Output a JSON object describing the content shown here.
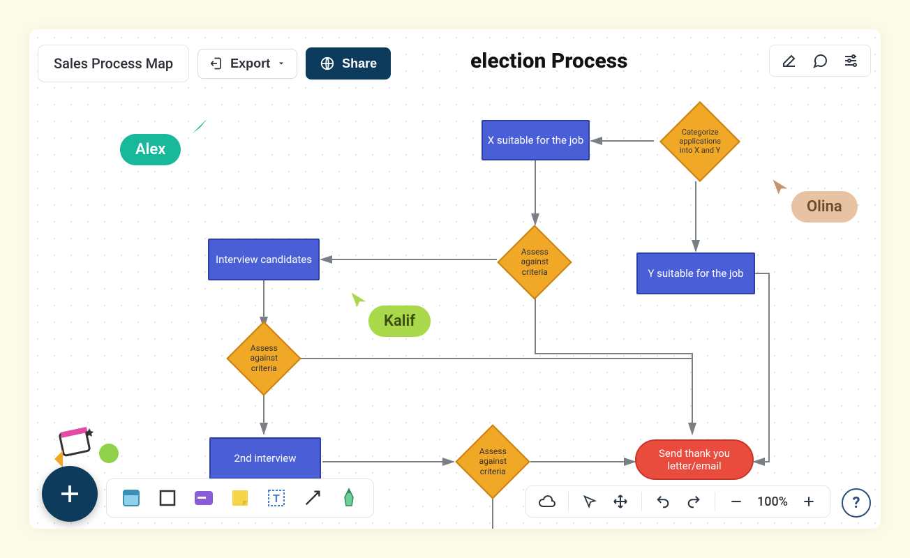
{
  "header": {
    "title": "Sales Process Map",
    "export_label": "Export",
    "share_label": "Share"
  },
  "canvas": {
    "title_partial": "election Process"
  },
  "cursors": {
    "alex": {
      "name": "Alex",
      "color": "#18b89b"
    },
    "kalif": {
      "name": "Kalif",
      "color": "#a9d94a"
    },
    "olina": {
      "name": "Olina",
      "color": "#e3b58f"
    }
  },
  "nodes": {
    "categorize": "Categorize applications into X and Y",
    "x_suitable": "X suitable for the job",
    "y_suitable": "Y suitable for the job",
    "assess1": "Assess against criteria",
    "assess2": "Assess against criteria",
    "assess3": "Assess against criteria",
    "interview": "Interview candidates",
    "interview2": "2nd interview",
    "sendthanks": "Send thank you letter/email"
  },
  "bottom": {
    "zoom": "100%"
  }
}
